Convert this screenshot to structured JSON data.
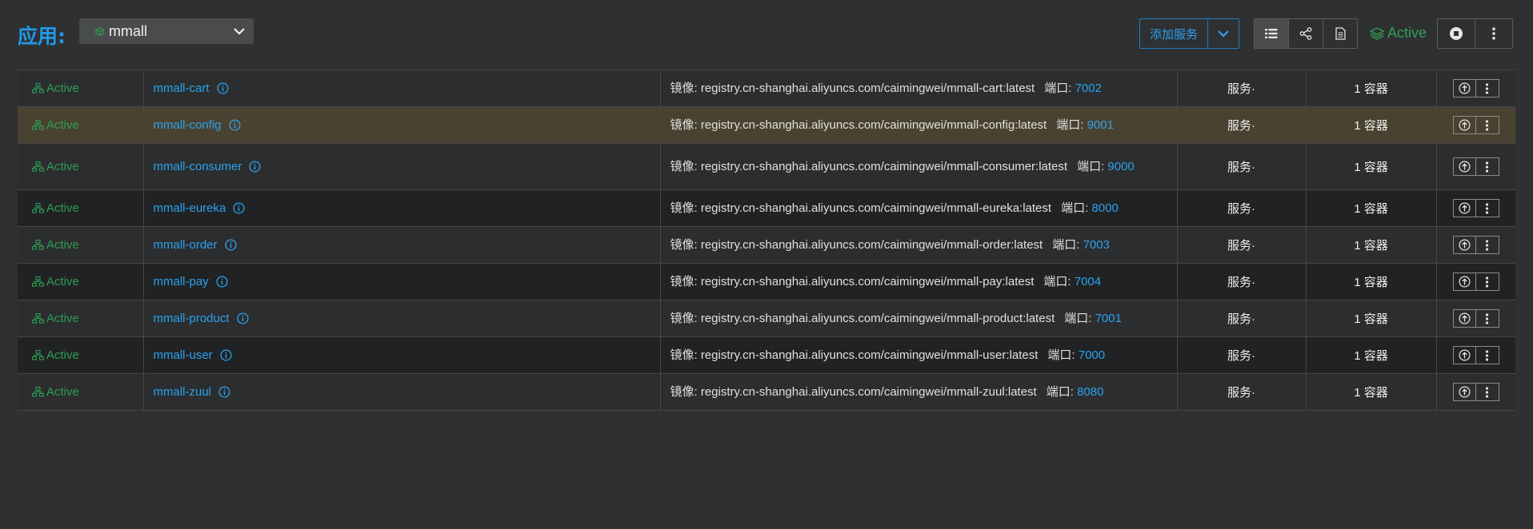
{
  "header": {
    "app_label": "应用:",
    "app_select_value": "mmall",
    "add_service_label": "添加服务",
    "state_label": "Active"
  },
  "colors": {
    "accent": "#1f9be8",
    "active_green": "#2e9e55",
    "highlight_row": "#4a4230",
    "background": "#2f3032"
  },
  "icons": {
    "app_select": "cube-icon",
    "add_service_dropdown": "chevron-down-icon",
    "view_modes": [
      "list-icon",
      "share-graph-icon",
      "document-icon"
    ],
    "state": "layers-icon",
    "power": "stop-circle-icon",
    "more": "kebab-icon",
    "row_state": "network-icon",
    "row_info": "info-icon",
    "row_upgrade": "upgrade-icon"
  },
  "services": [
    {
      "state": "Active",
      "name": "mmall-cart",
      "image_prefix": "镜像: ",
      "image": "registry.cn-shanghai.aliyuncs.com/caimingwei/mmall-cart:latest",
      "port_label": "端口: ",
      "port": "7002",
      "type": "服务·",
      "count": "1 容器"
    },
    {
      "state": "Active",
      "name": "mmall-config",
      "image_prefix": "镜像: ",
      "image": "registry.cn-shanghai.aliyuncs.com/caimingwei/mmall-config:latest",
      "port_label": "端口: ",
      "port": "9001",
      "type": "服务·",
      "count": "1 容器"
    },
    {
      "state": "Active",
      "name": "mmall-consumer",
      "image_prefix": "镜像: ",
      "image": "registry.cn-shanghai.aliyuncs.com/caimingwei/mmall-consumer:latest",
      "port_label": "端口: ",
      "port": "9000",
      "type": "服务·",
      "count": "1 容器"
    },
    {
      "state": "Active",
      "name": "mmall-eureka",
      "image_prefix": "镜像: ",
      "image": "registry.cn-shanghai.aliyuncs.com/caimingwei/mmall-eureka:latest",
      "port_label": "端口: ",
      "port": "8000",
      "type": "服务·",
      "count": "1 容器"
    },
    {
      "state": "Active",
      "name": "mmall-order",
      "image_prefix": "镜像: ",
      "image": "registry.cn-shanghai.aliyuncs.com/caimingwei/mmall-order:latest",
      "port_label": "端口: ",
      "port": "7003",
      "type": "服务·",
      "count": "1 容器"
    },
    {
      "state": "Active",
      "name": "mmall-pay",
      "image_prefix": "镜像: ",
      "image": "registry.cn-shanghai.aliyuncs.com/caimingwei/mmall-pay:latest",
      "port_label": "端口: ",
      "port": "7004",
      "type": "服务·",
      "count": "1 容器"
    },
    {
      "state": "Active",
      "name": "mmall-product",
      "image_prefix": "镜像: ",
      "image": "registry.cn-shanghai.aliyuncs.com/caimingwei/mmall-product:latest",
      "port_label": "端口: ",
      "port": "7001",
      "type": "服务·",
      "count": "1 容器"
    },
    {
      "state": "Active",
      "name": "mmall-user",
      "image_prefix": "镜像: ",
      "image": "registry.cn-shanghai.aliyuncs.com/caimingwei/mmall-user:latest",
      "port_label": "端口: ",
      "port": "7000",
      "type": "服务·",
      "count": "1 容器"
    },
    {
      "state": "Active",
      "name": "mmall-zuul",
      "image_prefix": "镜像: ",
      "image": "registry.cn-shanghai.aliyuncs.com/caimingwei/mmall-zuul:latest",
      "port_label": "端口: ",
      "port": "8080",
      "type": "服务·",
      "count": "1 容器"
    }
  ]
}
